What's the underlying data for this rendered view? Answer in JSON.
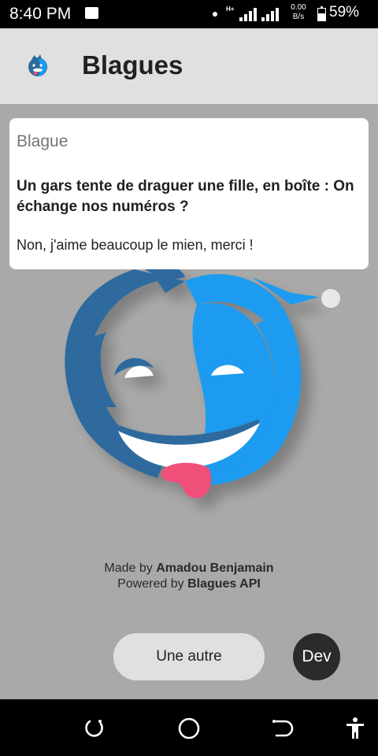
{
  "status_bar": {
    "time": "8:40 PM",
    "network_label": "H+",
    "speed_value": "0.00",
    "speed_unit": "B/s",
    "battery_percent": "59%"
  },
  "app_bar": {
    "title": "Blagues"
  },
  "card": {
    "title": "Blague",
    "setup": "Un gars tente de draguer une fille, en boîte : On échange nos numéros ?",
    "answer": "Non, j'aime beaucoup le mien, merci !"
  },
  "credits": {
    "made_by_prefix": "Made by ",
    "made_by_name": "Amadou Benjamain",
    "powered_by_prefix": "Powered by ",
    "powered_by_name": "Blagues API"
  },
  "actions": {
    "another_label": "Une autre",
    "dev_label": "Dev"
  },
  "colors": {
    "mascot_dark_blue": "#2d6b9e",
    "mascot_light_blue": "#1a9bf0",
    "tongue": "#f0507a",
    "background": "#a9a9a9",
    "appbar": "#e0e0e0"
  }
}
